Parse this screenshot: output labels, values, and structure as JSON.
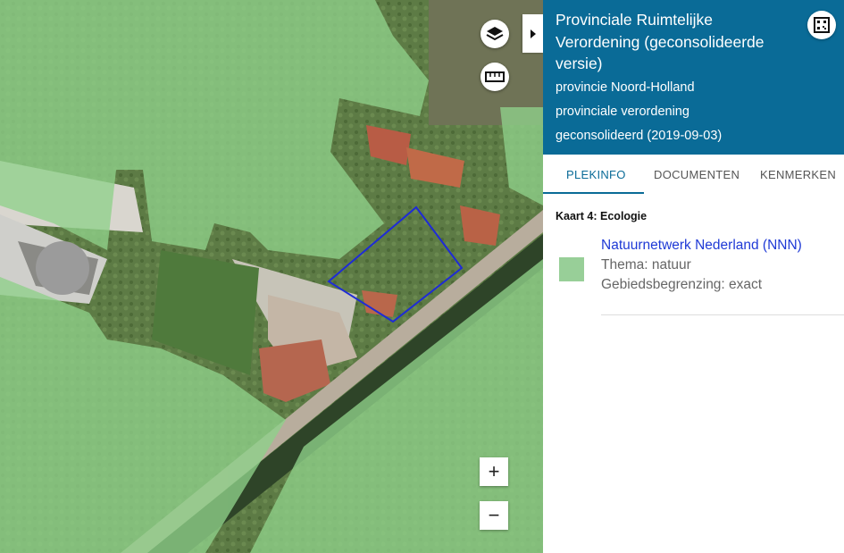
{
  "map": {
    "zoom_in_label": "+",
    "zoom_out_label": "−",
    "layers_icon": "layers-icon",
    "measure_icon": "ruler-icon",
    "collapse_icon": "caret-right-icon",
    "overlay_color": "#8fd18a",
    "selection_color": "#1e2bd6"
  },
  "panel": {
    "title": "Provinciale Ruimtelijke Verordening (geconsolideerde versie)",
    "meta": [
      "provincie Noord-Holland",
      "provinciale verordening",
      "geconsolideerd (2019-09-03)"
    ],
    "header_color": "#0a6b97",
    "qr_icon": "qr-icon",
    "tabs": [
      {
        "label": "PLEKINFO",
        "active": true
      },
      {
        "label": "DOCUMENTEN",
        "active": false
      },
      {
        "label": "KENMERKEN",
        "active": false
      }
    ],
    "section_title": "Kaart 4: Ecologie",
    "rule": {
      "name": "Natuurnetwerk Nederland (NNN)",
      "thema": "Thema: natuur",
      "begrenzing": "Gebiedsbegrenzing: exact",
      "swatch_color": "#98cf98"
    }
  }
}
